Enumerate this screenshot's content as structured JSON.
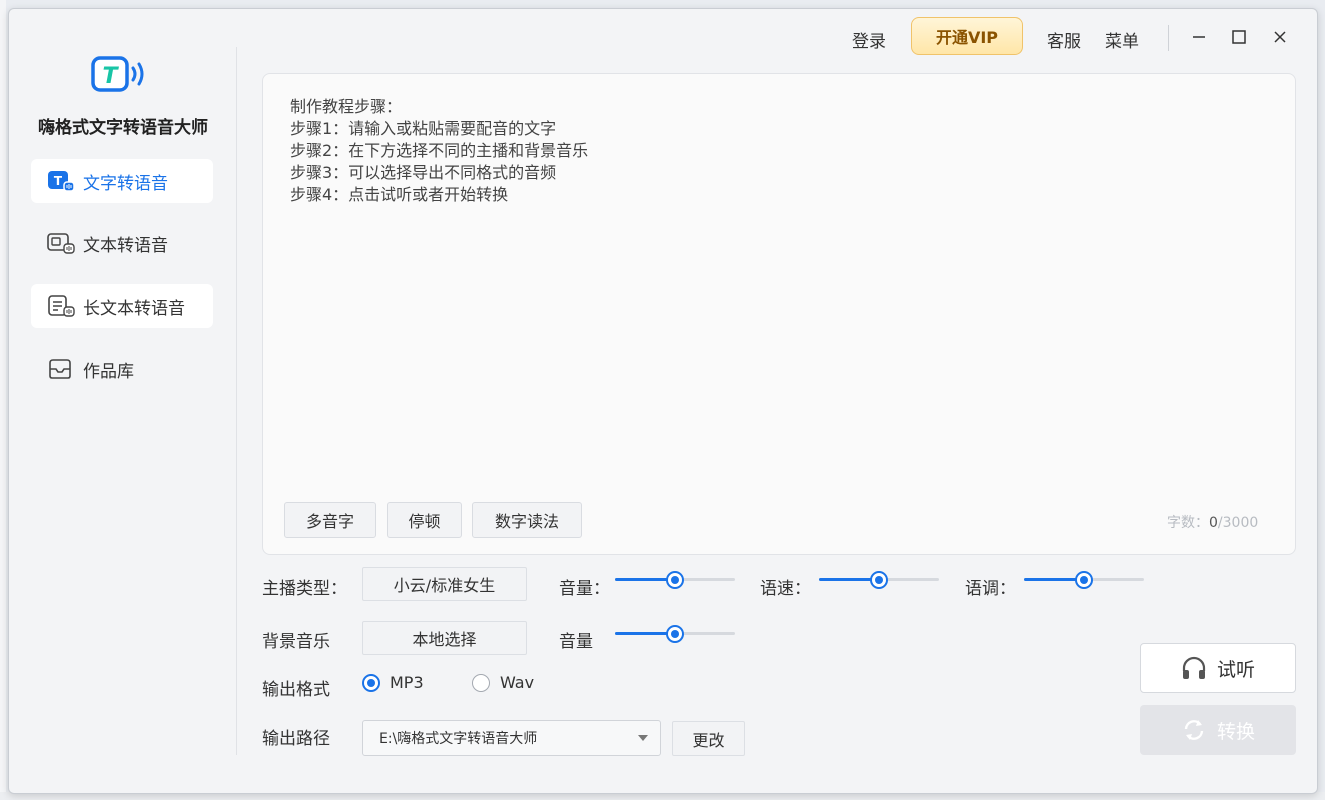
{
  "app": {
    "title": "嗨格式文字转语音大师"
  },
  "sidebar": {
    "items": [
      {
        "label": "文字转语音",
        "icon": "text-to-speech-icon",
        "active": true
      },
      {
        "label": "文本转语音",
        "icon": "file-to-speech-icon",
        "active": false
      },
      {
        "label": "长文本转语音",
        "icon": "long-text-to-speech-icon",
        "active": false
      },
      {
        "label": "作品库",
        "icon": "library-icon",
        "active": false
      }
    ]
  },
  "topbar": {
    "login": "登录",
    "vip": "开通VIP",
    "service": "客服",
    "menu": "菜单"
  },
  "editor": {
    "placeholder_lines": "制作教程步骤：\n步骤1：请输入或粘贴需要配音的文字\n步骤2：在下方选择不同的主播和背景音乐\n步骤3：可以选择导出不同格式的音频\n步骤4：点击试听或者开始转换",
    "tools": [
      "多音字",
      "停顿",
      "数字读法"
    ],
    "count_label": "字数：",
    "count_current": "0",
    "count_max": "/3000"
  },
  "controls": {
    "anchor_label": "主播类型：",
    "anchor_value": "小云/标准女生",
    "volume_label": "音量：",
    "speed_label": "语速：",
    "pitch_label": "语调：",
    "bgm_label": "背景音乐",
    "bgm_button": "本地选择",
    "bgm_volume_label": "音量",
    "format_label": "输出格式",
    "format_options": [
      "MP3",
      "Wav"
    ],
    "format_selected": "MP3",
    "path_label": "输出路径",
    "path_value": "E:\\嗨格式文字转语音大师",
    "change_button": "更改",
    "levels": {
      "volume": 0.5,
      "speed": 0.5,
      "pitch": 0.5,
      "bgm_volume": 0.5
    }
  },
  "actions": {
    "listen": "试听",
    "convert": "转换"
  },
  "colors": {
    "accent": "#1a73e8",
    "vip_text": "#8a5300",
    "disabled": "#e3e4e8"
  }
}
